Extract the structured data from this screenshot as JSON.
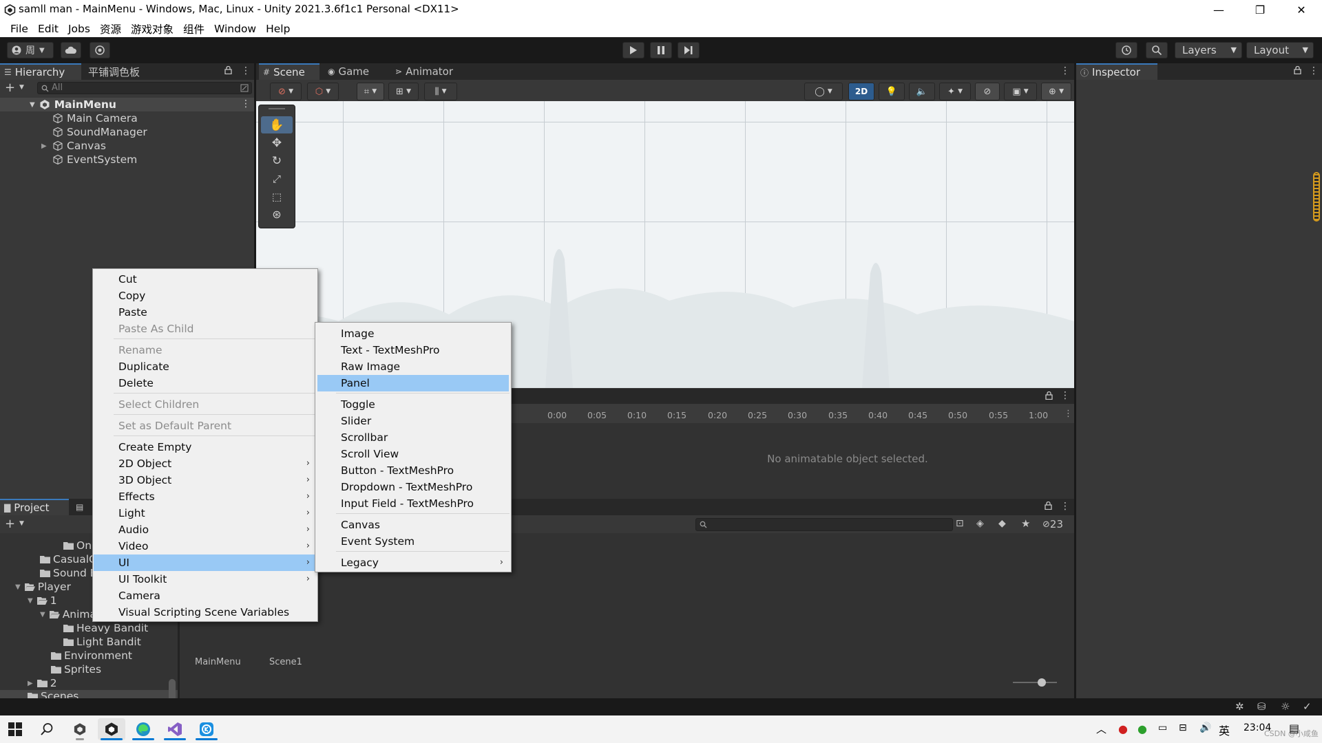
{
  "window": {
    "title": "samll man - MainMenu - Windows, Mac, Linux - Unity 2021.3.6f1c1 Personal <DX11>",
    "minimize": "—",
    "restore": "❐",
    "close": "✕"
  },
  "menubar": [
    "File",
    "Edit",
    "Jobs",
    "资源",
    "游戏对象",
    "组件",
    "Window",
    "Help"
  ],
  "toolbar": {
    "account_label": "周",
    "layers_label": "Layers",
    "layout_label": "Layout"
  },
  "hierarchy": {
    "tabs": [
      "Hierarchy",
      "平铺调色板"
    ],
    "search_placeholder": "All",
    "scene_name": "MainMenu",
    "items": [
      "Main Camera",
      "SoundManager",
      "Canvas",
      "EventSystem"
    ]
  },
  "scene_tabs": [
    "Scene",
    "Game",
    "Animator"
  ],
  "scene_toolbar": {
    "mode_2d": "2D"
  },
  "animation": {
    "ticks": [
      "0:00",
      "0:05",
      "0:10",
      "0:15",
      "0:20",
      "0:25",
      "0:30",
      "0:35",
      "0:40",
      "0:45",
      "0:50",
      "0:55",
      "1:00"
    ],
    "empty_message": "No animatable object selected."
  },
  "project": {
    "tab": "Project",
    "tree": [
      "On",
      "CasualG",
      "Sound E",
      "Player",
      "1",
      "Anima",
      "Heavy Bandit",
      "Light Bandit",
      "Environment",
      "Sprites",
      "2",
      "Scenes"
    ],
    "assets": [
      "MainMenu",
      "Scene1"
    ],
    "hidden_count": "23"
  },
  "inspector": {
    "tab": "Inspector"
  },
  "context_menu": {
    "items": [
      {
        "label": "Cut",
        "disabled": false
      },
      {
        "label": "Copy",
        "disabled": false
      },
      {
        "label": "Paste",
        "disabled": false
      },
      {
        "label": "Paste As Child",
        "disabled": true
      },
      {
        "label": "Rename",
        "disabled": true
      },
      {
        "label": "Duplicate",
        "disabled": false
      },
      {
        "label": "Delete",
        "disabled": false
      },
      {
        "label": "Select Children",
        "disabled": true
      },
      {
        "label": "Set as Default Parent",
        "disabled": true
      },
      {
        "label": "Create Empty",
        "disabled": false
      },
      {
        "label": "2D Object",
        "disabled": false,
        "submenu": true
      },
      {
        "label": "3D Object",
        "disabled": false,
        "submenu": true
      },
      {
        "label": "Effects",
        "disabled": false,
        "submenu": true
      },
      {
        "label": "Light",
        "disabled": false,
        "submenu": true
      },
      {
        "label": "Audio",
        "disabled": false,
        "submenu": true
      },
      {
        "label": "Video",
        "disabled": false,
        "submenu": true
      },
      {
        "label": "UI",
        "disabled": false,
        "submenu": true,
        "highlighted": true
      },
      {
        "label": "UI Toolkit",
        "disabled": false,
        "submenu": true
      },
      {
        "label": "Camera",
        "disabled": false
      },
      {
        "label": "Visual Scripting Scene Variables",
        "disabled": false
      }
    ]
  },
  "ui_submenu": {
    "items": [
      {
        "label": "Image"
      },
      {
        "label": "Text - TextMeshPro"
      },
      {
        "label": "Raw Image"
      },
      {
        "label": "Panel",
        "highlighted": true
      },
      {
        "label": "Toggle"
      },
      {
        "label": "Slider"
      },
      {
        "label": "Scrollbar"
      },
      {
        "label": "Scroll View"
      },
      {
        "label": "Button - TextMeshPro"
      },
      {
        "label": "Dropdown - TextMeshPro"
      },
      {
        "label": "Input Field - TextMeshPro"
      },
      {
        "label": "Canvas"
      },
      {
        "label": "Event System"
      },
      {
        "label": "Legacy",
        "submenu": true
      }
    ]
  },
  "taskbar": {
    "ime": "英",
    "time": "23:04",
    "watermark": "CSDN @小咸鱼"
  },
  "colors": {
    "highlight": "#99c9f5",
    "tab_accent": "#3a79bb",
    "editor_dark": "#383838"
  }
}
